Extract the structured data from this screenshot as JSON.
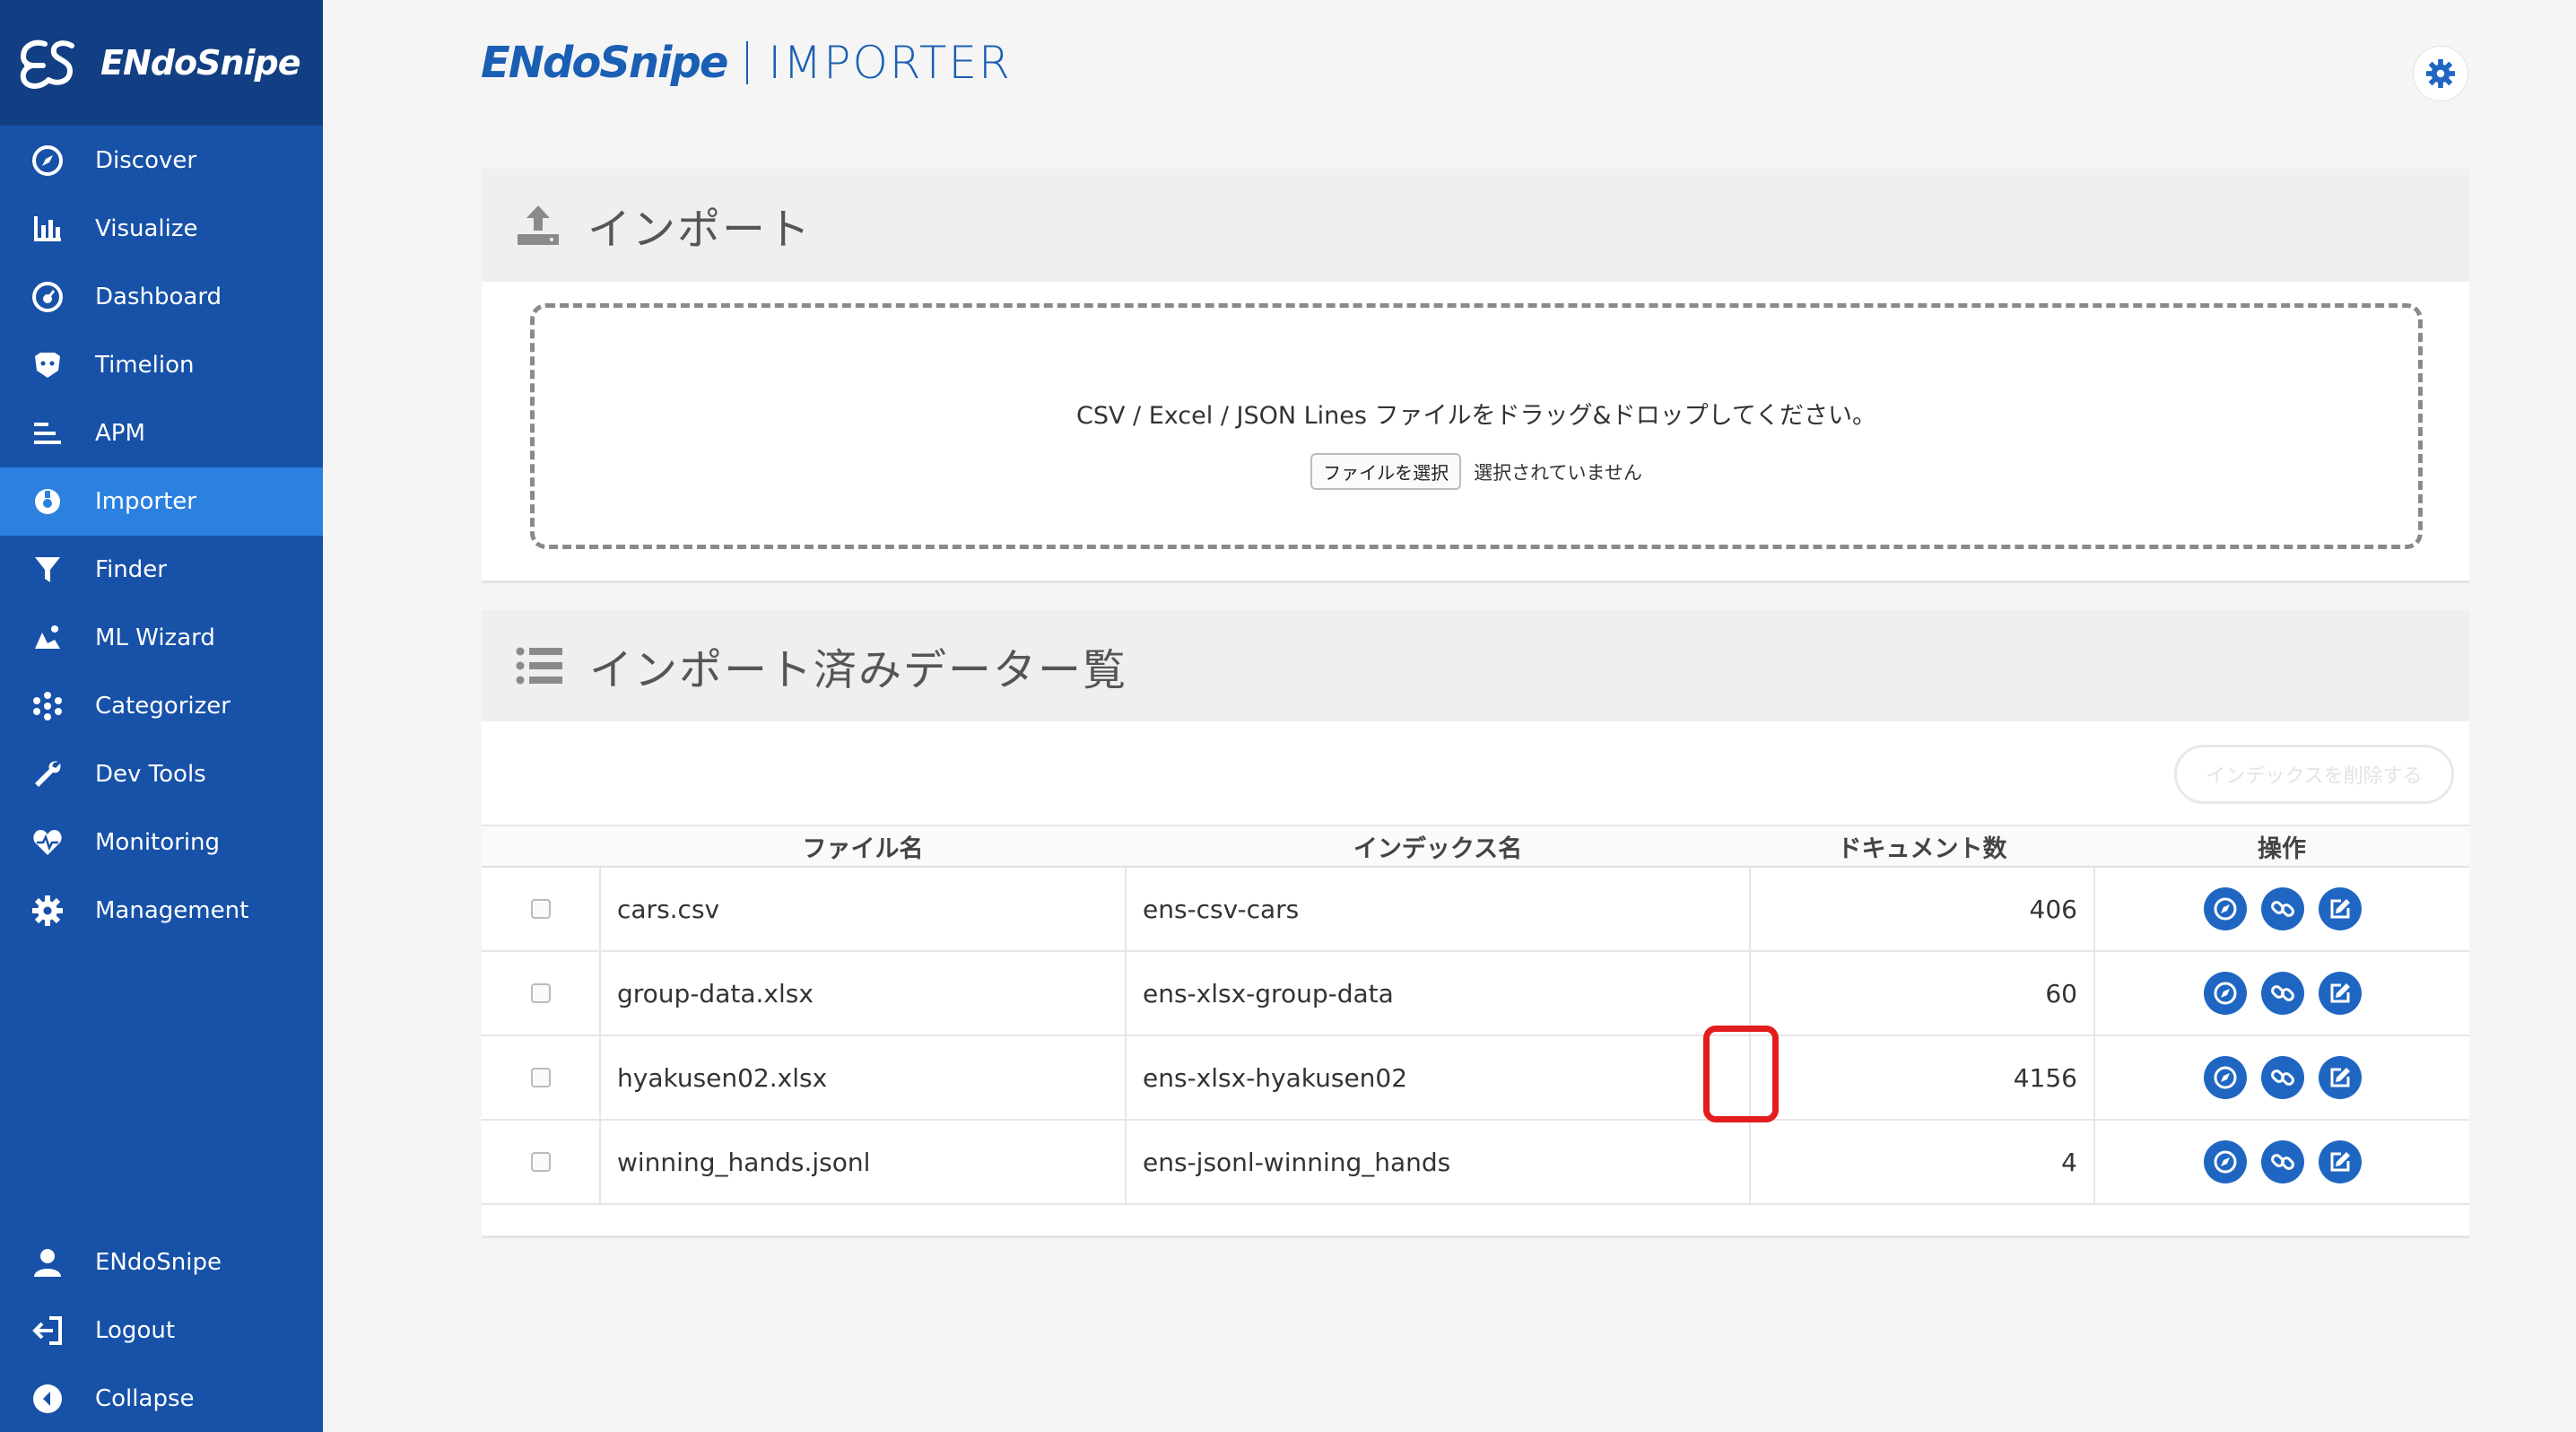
{
  "sidebar": {
    "brand": "ENdoSnipe",
    "items": [
      {
        "label": "Discover",
        "icon": "compass-icon"
      },
      {
        "label": "Visualize",
        "icon": "bar-chart-icon"
      },
      {
        "label": "Dashboard",
        "icon": "dashboard-icon"
      },
      {
        "label": "Timelion",
        "icon": "timelion-icon"
      },
      {
        "label": "APM",
        "icon": "apm-icon"
      },
      {
        "label": "Importer",
        "icon": "importer-icon",
        "active": true
      },
      {
        "label": "Finder",
        "icon": "filter-icon"
      },
      {
        "label": "ML Wizard",
        "icon": "ml-wizard-icon"
      },
      {
        "label": "Categorizer",
        "icon": "categorizer-icon"
      },
      {
        "label": "Dev Tools",
        "icon": "wrench-icon"
      },
      {
        "label": "Monitoring",
        "icon": "heartbeat-icon"
      },
      {
        "label": "Management",
        "icon": "gear-icon"
      }
    ],
    "bottom": [
      {
        "label": "ENdoSnipe",
        "icon": "user-icon"
      },
      {
        "label": "Logout",
        "icon": "logout-icon"
      },
      {
        "label": "Collapse",
        "icon": "collapse-icon"
      }
    ]
  },
  "header": {
    "brand": "ENdoSnipe",
    "product": "IMPORTER"
  },
  "import_panel": {
    "title": "インポート",
    "drop_text": "CSV / Excel / JSON Lines ファイルをドラッグ&ドロップしてください。",
    "file_button": "ファイルを選択",
    "file_status": "選択されていません"
  },
  "list_panel": {
    "title": "インポート済みデーター覧",
    "delete_button": "インデックスを削除する",
    "columns": [
      "ファイル名",
      "インデックス名",
      "ドキュメント数",
      "操作"
    ],
    "rows": [
      {
        "file": "cars.csv",
        "index": "ens-csv-cars",
        "docs": "406"
      },
      {
        "file": "group-data.xlsx",
        "index": "ens-xlsx-group-data",
        "docs": "60"
      },
      {
        "file": "hyakusen02.xlsx",
        "index": "ens-xlsx-hyakusen02",
        "docs": "4156"
      },
      {
        "file": "winning_hands.jsonl",
        "index": "ens-jsonl-winning_hands",
        "docs": "4"
      }
    ]
  },
  "colors": {
    "sidebar": "#1751a8",
    "sidebar_brand": "#123f84",
    "active": "#2b80e0",
    "action": "#1f66c2",
    "highlight": "#e31d1d"
  }
}
